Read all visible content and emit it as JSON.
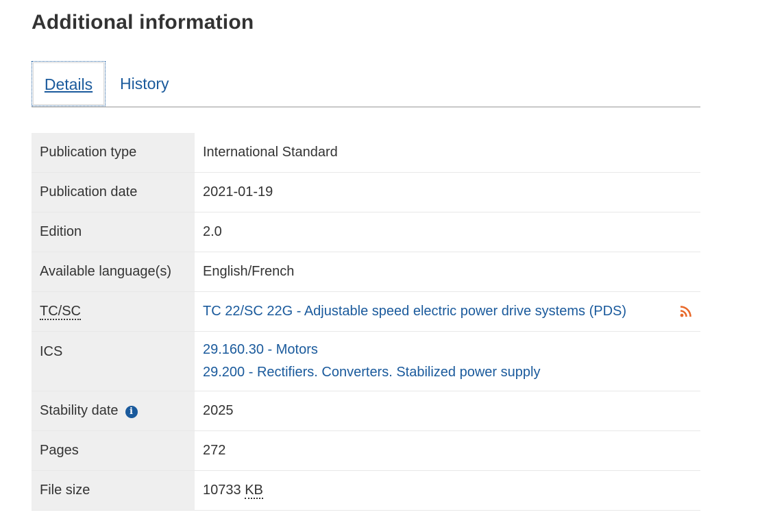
{
  "section_title": "Additional information",
  "tabs": [
    {
      "label": "Details",
      "active": true
    },
    {
      "label": "History",
      "active": false
    }
  ],
  "details": {
    "publication_type": {
      "label": "Publication type",
      "value": "International Standard"
    },
    "publication_date": {
      "label": "Publication date",
      "value": "2021-01-19"
    },
    "edition": {
      "label": "Edition",
      "value": "2.0"
    },
    "languages": {
      "label": "Available language(s)",
      "value": "English/French"
    },
    "tc_sc": {
      "label": "TC/SC",
      "value": "TC 22/SC 22G - Adjustable speed electric power drive systems (PDS)",
      "icon": "rss-icon"
    },
    "ics": {
      "label": "ICS",
      "values": [
        "29.160.30 - Motors",
        "29.200 - Rectifiers. Converters. Stabilized power supply"
      ]
    },
    "stability_date": {
      "label": "Stability date",
      "value": "2025",
      "icon": "info-icon"
    },
    "pages": {
      "label": "Pages",
      "value": "272"
    },
    "file_size": {
      "label": "File size",
      "value": "10733",
      "unit": "KB"
    }
  },
  "colors": {
    "link": "#1a5a9c",
    "rss": "#e8692a",
    "label_bg": "#efefef"
  }
}
